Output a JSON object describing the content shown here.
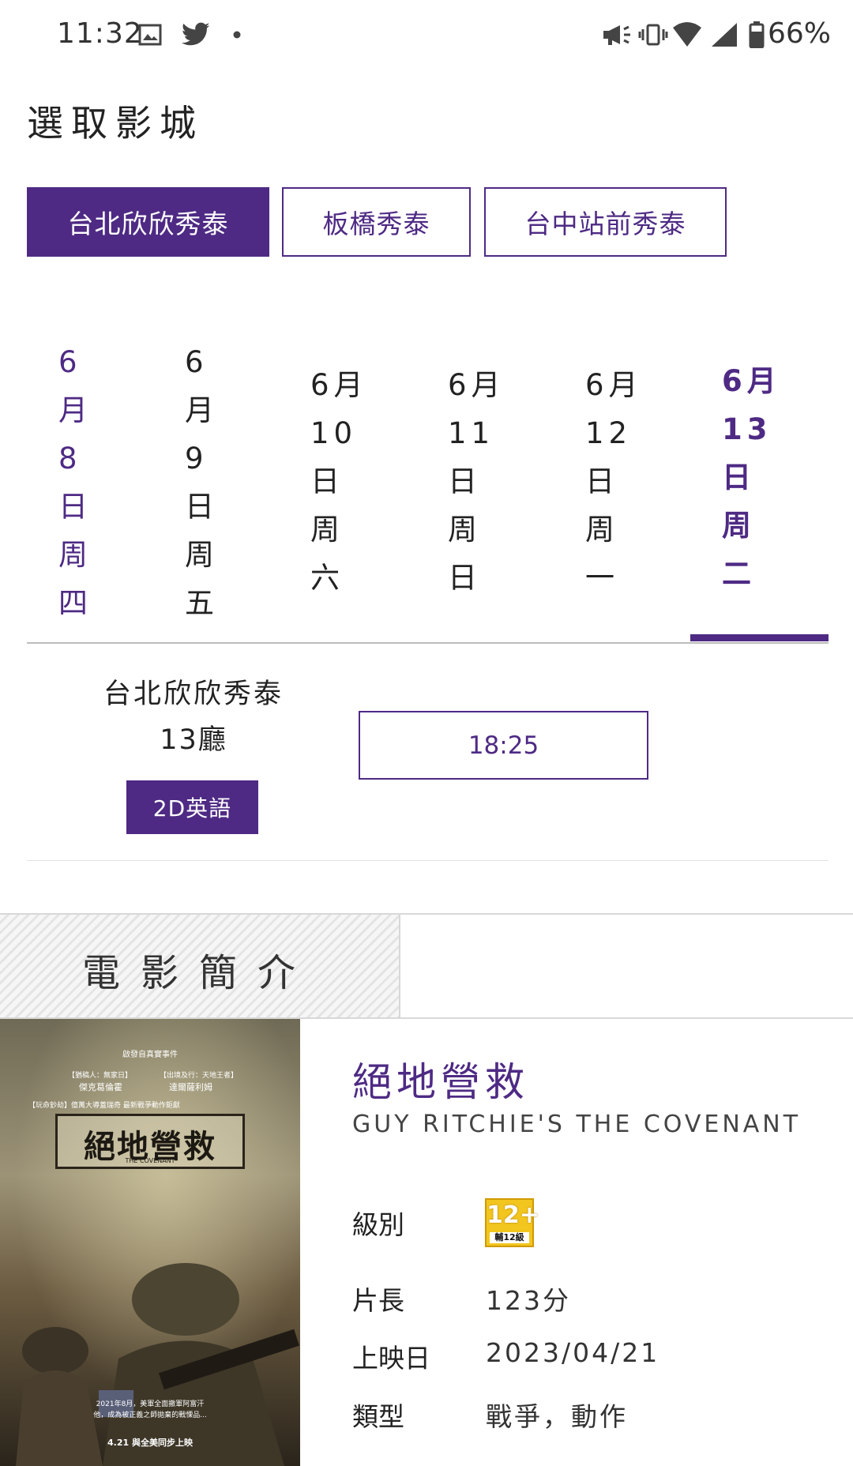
{
  "status_bar": {
    "time": "11:32",
    "battery": "66%",
    "icons": [
      "gallery-icon",
      "twitter-icon",
      "dot-icon",
      "megaphone-icon",
      "vibrate-icon",
      "wifi-icon",
      "signal-icon",
      "battery-icon"
    ]
  },
  "page_title": "選取影城",
  "cinemas": [
    {
      "label": "台北欣欣秀泰",
      "selected": true
    },
    {
      "label": "板橋秀泰",
      "selected": false
    },
    {
      "label": "台中站前秀泰",
      "selected": false
    }
  ],
  "dates": [
    {
      "lines": [
        "6",
        "月",
        "8",
        "日",
        "周",
        "四"
      ]
    },
    {
      "lines": [
        "6",
        "月",
        "9",
        "日",
        "周",
        "五"
      ]
    },
    {
      "lines": [
        "6月",
        "10",
        "日",
        "周",
        "六"
      ]
    },
    {
      "lines": [
        "6月",
        "11",
        "日",
        "周",
        "日"
      ]
    },
    {
      "lines": [
        "6月",
        "12",
        "日",
        "周",
        "一"
      ]
    },
    {
      "lines": [
        "6月",
        "13",
        "日",
        "周",
        "二"
      ],
      "selected": true
    }
  ],
  "showtime": {
    "cinema": "台北欣欣秀泰",
    "hall": "13廳",
    "format": "2D英語",
    "times": [
      "18:25"
    ]
  },
  "synopsis": {
    "header": "電影簡介",
    "title_zh": "絕地營救",
    "title_en": "GUY RITCHIE'S THE COVENANT",
    "rating_label": "級別",
    "rating_badge_num": "12+",
    "rating_badge_text": "輔12級",
    "length_label": "片長",
    "length_value": "123分",
    "release_label": "上映日",
    "release_value": "2023/04/21",
    "genre_label": "類型",
    "genre_value": "戰爭，動作"
  },
  "poster": {
    "tagline": "啟發自真實事件",
    "cast_left_role": "【猶稿人：無家日】",
    "cast_left_name": "傑克葛倫霍",
    "cast_right_role": "【出境及行：天地王者】",
    "cast_right_name": "達爾薩利姆",
    "director_line": "【玩命鈔劫】億萬大導蓋瑞奇 最新戰爭動作鉅獻",
    "title": "絕地營救",
    "title_en": "THE COVENANT",
    "bottom_line1": "2021年8月，美軍全面撤軍阿富汗",
    "bottom_line2": "他，成為被正義之師拋棄的戰慄品...",
    "release_line": "4.21 與全美同步上映"
  },
  "colors": {
    "accent": "#4e2a84",
    "rating_badge": "#f2c61f"
  }
}
